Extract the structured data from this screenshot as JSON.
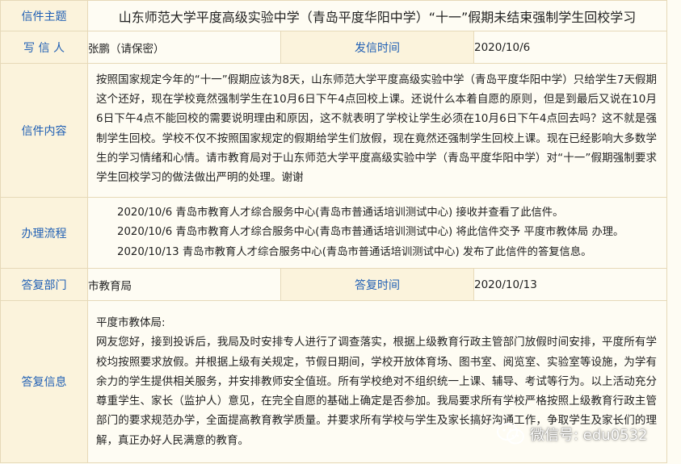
{
  "letter": {
    "subject_label": "信件主题",
    "subject": "山东师范大学平度高级实验中学（青岛平度华阳中学）“十一”假期未结束强制学生回校学习",
    "author_label": "写 信 人",
    "author": "张鹏（请保密）",
    "sent_time_label": "发信时间",
    "sent_time": "2020/10/6",
    "content_label": "信件内容",
    "content": "按照国家规定今年的“十一”假期应该为8天，山东师范大学平度高级实验中学（青岛平度华阳中学）只给学生7天假期这个还好，现在学校竟然强制学生在10月6日下午4点回校上课。还说什么本着自愿的原则，但是到最后又说在10月6日下午4点不能回校的需要说明理由和原因，这不就表明了学校让学生必须在10月6日下午4点回去吗？这不就是强制学生回校。学校不仅不按照国家规定的假期给学生们放假，现在竟然还强制学生回校上课。现在已经影响大多数学生的学习情绪和心情。请市教育局对于山东师范大学平度高级实验中学（青岛平度华阳中学）对“十一”假期强制要求学生回校学习的做法做出严明的处理。谢谢",
    "process_label": "办理流程",
    "process": [
      "2020/10/6   青岛市教育人才综合服务中心(青岛市普通话培训测试中心)  接收并查看了此信件。",
      "2020/10/6   青岛市教育人才综合服务中心(青岛市普通话培训测试中心)  将此信件交予  平度市教体局  办理。",
      "2020/10/13   青岛市教育人才综合服务中心(青岛市普通话培训测试中心)  发布了此信件的答复信息。"
    ],
    "reply_dept_label": "答复部门",
    "reply_dept": "市教育局",
    "reply_time_label": "答复时间",
    "reply_time": "2020/10/13",
    "reply_label": "答复信息",
    "reply_greeting": "平度市教体局:",
    "reply_body": "网友您好，接到投诉后，我局及时安排专人进行了调查落实，根据上级教育行政主管部门放假时间安排，平度所有学校均按照要求放假。并根据上级有关规定，节假日期间，学校开放体育场、图书室、阅览室、实验室等设施，为学有余力的学生提供相关服务，并安排教师安全值班。所有学校绝对不组织统一上课、辅导、考试等行为。以上活动充分尊重学生、家长（监护人）意见，在完全自愿的基础上确定是否参加。我局要求所有学校严格按照上级教育行政主管部门的要求规范办学，全面提高教育教学质量。并要求所有学校与学生及家长搞好沟通工作，争取学生及家长们的理解，真正办好人民满意的教育。"
  },
  "watermark": {
    "text": "微信号: edu0532",
    "icon": "wechat-icon"
  }
}
